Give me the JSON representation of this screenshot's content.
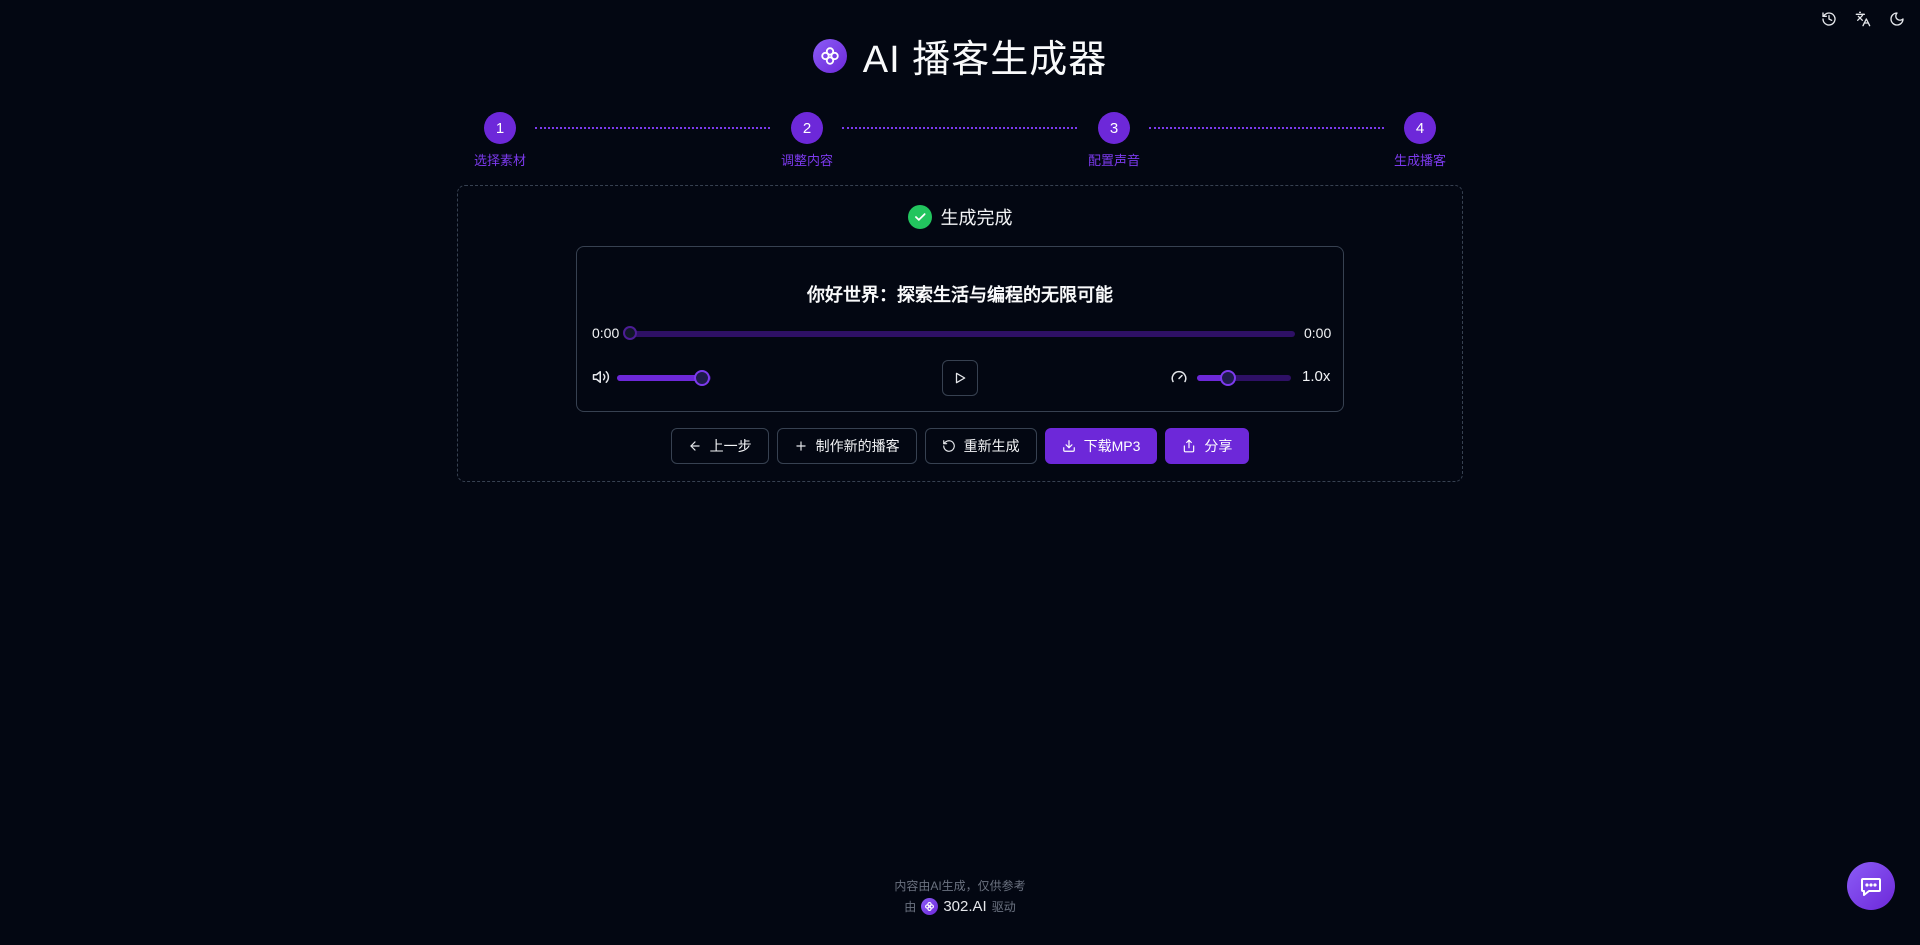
{
  "app": {
    "title": "AI 播客生成器",
    "logo_icon": "flower-icon",
    "accent_color": "#6d28d9"
  },
  "top_icons": [
    "history-icon",
    "translate-icon",
    "theme-toggle-icon"
  ],
  "steps": [
    {
      "number": "1",
      "label": "选择素材"
    },
    {
      "number": "2",
      "label": "调整内容"
    },
    {
      "number": "3",
      "label": "配置声音"
    },
    {
      "number": "4",
      "label": "生成播客"
    }
  ],
  "status": {
    "text": "生成完成",
    "color": "#22c55e"
  },
  "player": {
    "episode_title": "你好世界：探索生活与编程的无限可能",
    "current_time": "0:00",
    "duration": "0:00",
    "progress": 0,
    "volume": 0.9,
    "speed_label": "1.0x",
    "speed": 1.0,
    "speed_range": [
      0.5,
      2.0
    ]
  },
  "actions": {
    "back": "上一步",
    "new_podcast": "制作新的播客",
    "regenerate": "重新生成",
    "download": "下载MP3",
    "share": "分享"
  },
  "footer": {
    "disclaimer": "内容由AI生成，仅供参考",
    "by": "由",
    "brand": "302.AI",
    "powered": "驱动"
  }
}
